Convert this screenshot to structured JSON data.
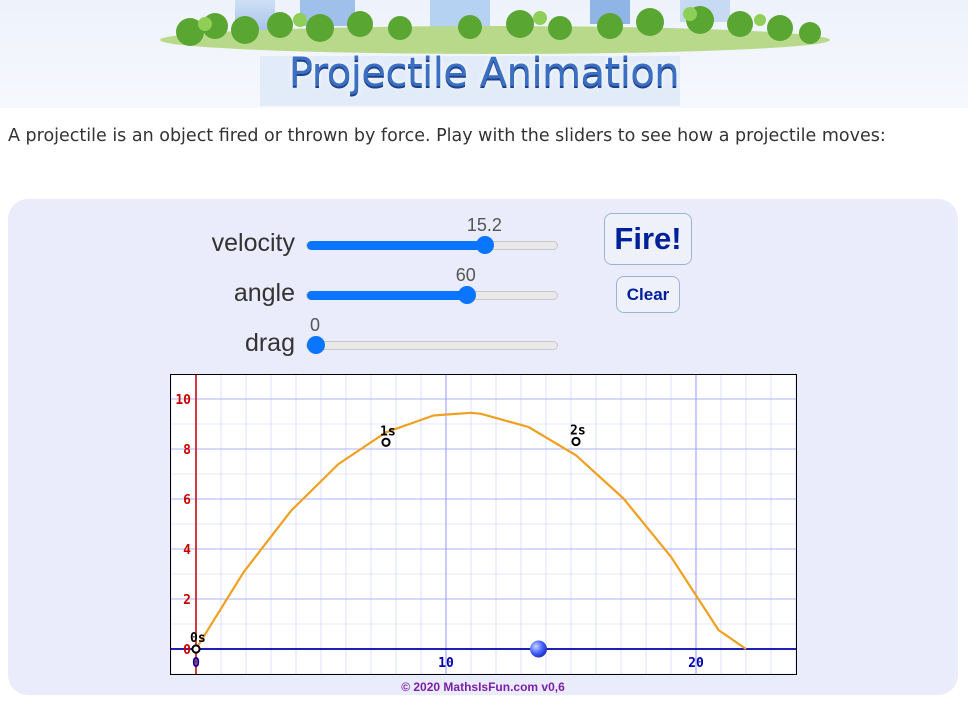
{
  "banner": {
    "title": "Projectile Animation"
  },
  "intro": "A projectile is an object fired or thrown by force. Play with the sliders to see how a projectile moves:",
  "sliders": [
    {
      "label": "velocity",
      "value": "15.2",
      "fraction": 0.73
    },
    {
      "label": "angle",
      "value": "60",
      "fraction": 0.65
    },
    {
      "label": "drag",
      "value": "0",
      "fraction": 0.0
    }
  ],
  "buttons": {
    "fire": "Fire!",
    "clear": "Clear"
  },
  "chart_data": {
    "type": "line",
    "xlim": [
      -1,
      23.9
    ],
    "ylim": [
      -1,
      11
    ],
    "x_ticks": [
      "0",
      "10",
      "20"
    ],
    "y_ticks": [
      "0",
      "2",
      "4",
      "6",
      "8",
      "10"
    ],
    "grid": true,
    "series": [
      {
        "x": [
          0,
          1.9,
          3.8,
          5.7,
          7.6,
          9.5,
          11.0,
          11.4,
          13.3,
          15.2,
          17.1,
          19.0,
          20.9,
          22.0
        ],
        "y": [
          0,
          3.07,
          5.53,
          7.4,
          8.67,
          9.34,
          9.45,
          9.41,
          8.88,
          7.75,
          6.02,
          3.69,
          0.76,
          0.0
        ]
      }
    ],
    "markers": [
      {
        "label": "0s",
        "x": 0.0,
        "y": 0.0
      },
      {
        "label": "1s",
        "x": 7.6,
        "y": 8.27
      },
      {
        "label": "2s",
        "x": 15.2,
        "y": 8.3
      }
    ],
    "ball": {
      "x": 13.7,
      "y": 0
    }
  },
  "colors": {
    "trajectory": "#f0a020",
    "ground": "#0000aa",
    "y_axis": "#cc0000",
    "grid": "#9aa0ff",
    "ball": "#3f5fff"
  },
  "copyright": "© 2020 MathsIsFun.com v0,6"
}
